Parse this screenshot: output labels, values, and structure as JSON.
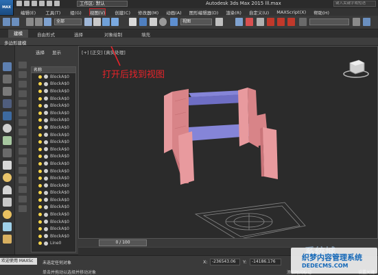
{
  "app": {
    "logo_text": "MAX",
    "workspace": "工作区: 默认",
    "title": "Autodesk 3ds Max  2015      lll.max",
    "search_placeholder": "键入关键字或短语"
  },
  "menu": [
    "编辑(E)",
    "工具(T)",
    "组(G)",
    "视图(V)",
    "创建(C)",
    "修改器(M)",
    "动画(A)",
    "图形编辑器(D)",
    "渲染(R)",
    "自定义(U)",
    "MAXScript(X)",
    "帮助(H)"
  ],
  "toolbar": {
    "selection_filter": "全部",
    "view_dropdown": "视图"
  },
  "ribbon": {
    "tabs": [
      "建模",
      "自由形式",
      "选择",
      "对象绘制",
      "填充"
    ],
    "sub_tab": "多边形建模"
  },
  "explorer": {
    "tabs": [
      "选择",
      "显示"
    ],
    "column_header": "名称",
    "items": [
      "BlockA$0",
      "BlockA$0",
      "BlockA$0",
      "BlockA$0",
      "BlockA$0",
      "BlockA$0",
      "BlockA$0",
      "BlockA$0",
      "BlockA$0",
      "BlockA$0",
      "BlockA$0",
      "BlockA$0",
      "BlockA$0",
      "BlockA$0",
      "BlockA$0",
      "BlockA$0",
      "BlockA$0",
      "BlockA$0",
      "BlockA$0",
      "BlockA$0",
      "BlockA$0",
      "BlockA$0",
      "BlockA$0",
      "Line0"
    ]
  },
  "viewport": {
    "label": "[+] [正交] [真实处理]",
    "annotation": "打开后找到视图",
    "annotation_color": "#e8232a"
  },
  "timeline": {
    "frame": "0 / 100"
  },
  "status": {
    "welcome": "欢迎使用 MAXSc",
    "message": "未选定任何对象",
    "prompt": "单击并拖动以选择并移动对象",
    "x_label": "X:",
    "x_value": "-236543.06",
    "y_label": "Y:",
    "y_value": "-14186.176",
    "add_time_tag": "添加时间标记",
    "set_key": "设置关键"
  },
  "watermark": {
    "brand_cn": "系统城",
    "name": "织梦内容管理系统",
    "domain": "DEDECMS.COM"
  },
  "colors": {
    "wall": "#e89a9e",
    "beam": "#8585d8",
    "accent": "#c9242b"
  }
}
